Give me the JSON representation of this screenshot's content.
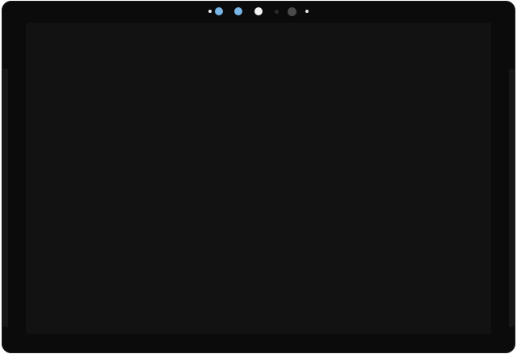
{
  "device": {
    "bezel_color": "#0b0b0b",
    "screen_color": "#121212",
    "sensor_colors": {
      "small_dot": "#e8e8e8",
      "blue_lens": "#79b6e6",
      "white_lens": "#f2f2f2",
      "dark_lens": "#2a2a2a",
      "gray_lens": "#4a4a4a"
    }
  }
}
